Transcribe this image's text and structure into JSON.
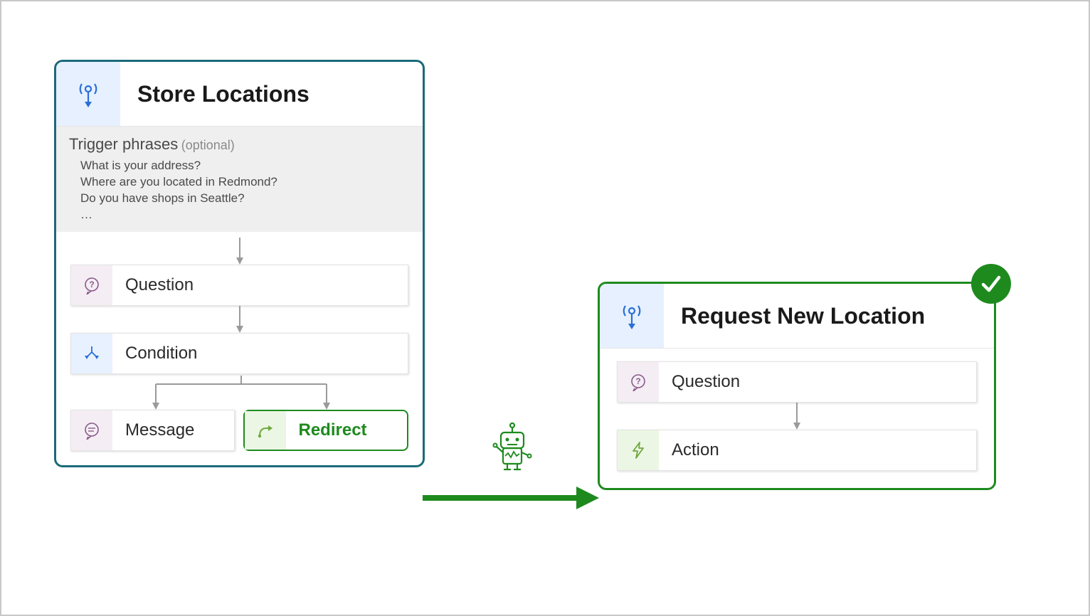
{
  "left_topic": {
    "title": "Store Locations",
    "trigger_label": "Trigger phrases",
    "trigger_optional": "(optional)",
    "trigger_phrases": [
      "What is your address?",
      "Where are you located in Redmond?",
      "Do you have shops in Seattle?",
      "…"
    ],
    "nodes": {
      "question": "Question",
      "condition": "Condition",
      "message": "Message",
      "redirect": "Redirect"
    }
  },
  "right_topic": {
    "title": "Request New Location",
    "nodes": {
      "question": "Question",
      "action": "Action"
    }
  },
  "icons": {
    "topic": "topic-broadcast-icon",
    "question": "question-bubble-icon",
    "condition": "branch-icon",
    "message": "chat-bubble-icon",
    "redirect": "route-arrow-icon",
    "action": "lightning-icon",
    "robot": "robot-icon",
    "check": "checkmark-icon"
  },
  "colors": {
    "teal_border": "#1b6a7a",
    "green": "#1e8a1e",
    "purple_icon": "#8a5a8a",
    "blue_icon": "#2a6fd6",
    "green_icon": "#6fa83e"
  }
}
